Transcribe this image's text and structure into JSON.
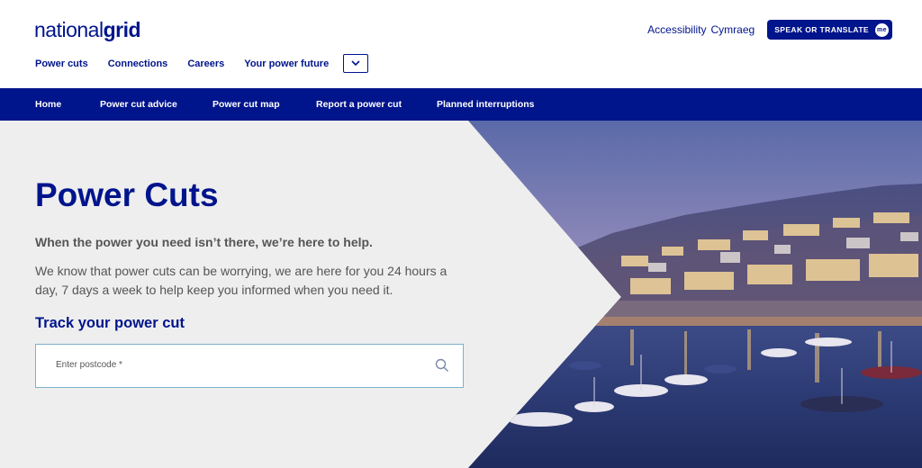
{
  "brand": {
    "logo_part1": "national",
    "logo_part2": "grid"
  },
  "utility": {
    "accessibility": "Accessibility",
    "cymraeg": "Cymraeg",
    "speak_label": "SPEAK OR TRANSLATE",
    "speak_badge": "me"
  },
  "subnav": {
    "items": [
      "Power cuts",
      "Connections",
      "Careers",
      "Your power future"
    ],
    "dropdown_icon": "chevron-down-icon"
  },
  "mainnav": {
    "items": [
      "Home",
      "Power cut advice",
      "Power cut map",
      "Report a power cut",
      "Planned interruptions"
    ]
  },
  "hero": {
    "title": "Power Cuts",
    "lead": "When the power you need isn’t there, we’re here to help.",
    "body": "We know that power cuts can be worrying, we are here for you 24 hours a day, 7 days a week to help keep you informed when you need it.",
    "track_heading": "Track your power cut",
    "postcode_placeholder": "Enter postcode *",
    "search_icon": "search-icon"
  },
  "colors": {
    "brand_blue": "#00148c",
    "hero_bg": "#eeeeee",
    "input_border": "#7fb0cc"
  }
}
